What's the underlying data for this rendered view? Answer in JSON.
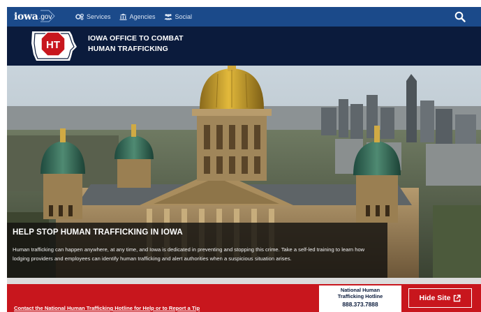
{
  "topbar": {
    "logo_text": "iowa",
    "logo_suffix": ".gov",
    "nav": [
      {
        "label": "Services",
        "icon": "gears-icon"
      },
      {
        "label": "Agencies",
        "icon": "capitol-building-icon"
      },
      {
        "label": "Social",
        "icon": "people-icon"
      }
    ],
    "search_icon": "search-icon"
  },
  "agency": {
    "badge_text": "HT",
    "title_line1": "IOWA OFFICE TO COMBAT",
    "title_line2": "HUMAN TRAFFICKING"
  },
  "hero": {
    "heading": "HELP STOP HUMAN TRAFFICKING IN IOWA",
    "body": "Human trafficking can happen anywhere, at any time, and Iowa is dedicated in preventing and stopping this crime. Take a self-led training to learn how lodging providers and employees can identify human trafficking and alert authorities when a suspicious situation arises."
  },
  "footer_bar": {
    "link_text": "Contact the National Human Trafficking Hotline for Help or to Report a Tip",
    "hotline_label_line1": "National Human",
    "hotline_label_line2": "Trafficking Hotline",
    "hotline_number": "888.373.7888",
    "hide_label": "Hide Site",
    "hide_icon": "external-link-icon"
  },
  "colors": {
    "topbar": "#1b4a8a",
    "agency_header": "#0b1b3c",
    "alert_red": "#c8161d"
  }
}
